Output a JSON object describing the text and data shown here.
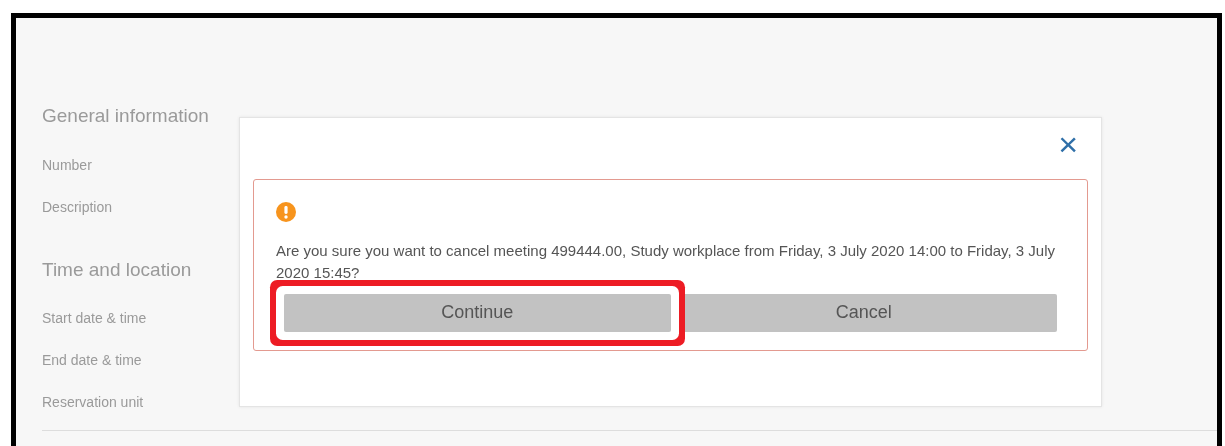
{
  "sections": [
    {
      "title": "General information",
      "fields": [
        "Number",
        "Description"
      ]
    },
    {
      "title": "Time and location",
      "fields": [
        "Start date & time",
        "End date & time",
        "Reservation unit"
      ]
    }
  ],
  "dialog": {
    "close": "×",
    "alert": {
      "kind": "warning",
      "message": "Are you sure you want to cancel meeting 499444.00, Study workplace from Friday, 3 July 2020 14:00 to Friday, 3 July 2020 15:45?"
    },
    "buttons": [
      {
        "label": "Continue",
        "highlighted": true
      },
      {
        "label": "Cancel",
        "highlighted": false
      }
    ]
  }
}
